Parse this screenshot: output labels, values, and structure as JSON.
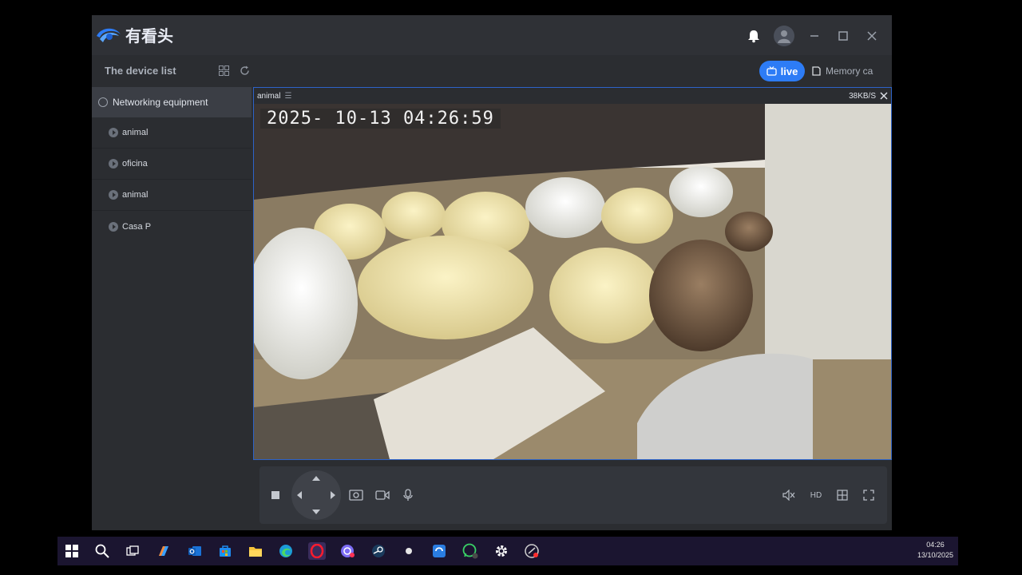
{
  "app": {
    "logo_text": "有看头"
  },
  "header": {
    "device_list_title": "The device list",
    "live_label": "live",
    "memory_tab_label": "Memory ca"
  },
  "sidebar": {
    "group": "Networking equipment",
    "items": [
      {
        "label": "animal"
      },
      {
        "label": "oficina"
      },
      {
        "label": "animal"
      },
      {
        "label": "Casa P"
      }
    ]
  },
  "video": {
    "channel_name": "animal",
    "bitrate": "38KB/S",
    "timestamp": "2025- 10-13   04:26:59"
  },
  "controls": {
    "hd_label": "HD"
  },
  "taskbar": {
    "time": "04:26",
    "date": "13/10/2025"
  },
  "colors": {
    "accent": "#2d7cf6",
    "panel_border": "#2d63c8",
    "window_bg": "#2b2d31"
  }
}
